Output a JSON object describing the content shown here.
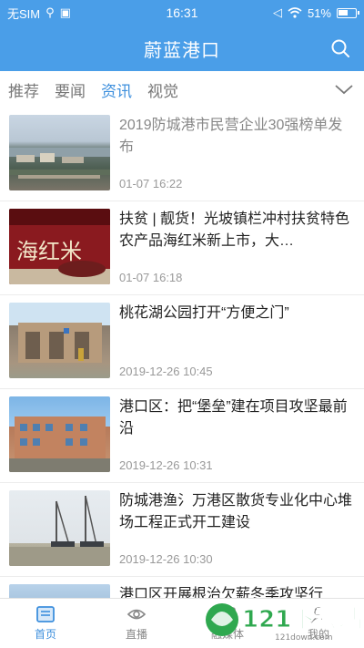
{
  "status_bar": {
    "carrier": "无SIM",
    "time": "16:31",
    "battery": "51%"
  },
  "header": {
    "title": "蔚蓝港口",
    "search_icon": "search-icon"
  },
  "tabs": {
    "items": [
      {
        "label": "推荐",
        "active": false
      },
      {
        "label": "要闻",
        "active": false
      },
      {
        "label": "资讯",
        "active": true
      },
      {
        "label": "视觉",
        "active": false
      }
    ],
    "expand_icon": "chevron-down-icon"
  },
  "news": [
    {
      "title": "2019防城港市民营企业30强榜单发布",
      "time": "01-07 16:22",
      "read": true
    },
    {
      "title": "扶贫 | 靓货！光坡镇栏冲村扶贫特色农产品海红米新上市，大…",
      "time": "01-07 16:18",
      "read": false,
      "thumb_text": "海红米"
    },
    {
      "title": "桃花湖公园打开“方便之门”",
      "time": "2019-12-26 10:45",
      "read": false
    },
    {
      "title": "港口区：把“堡垒”建在项目攻坚最前沿",
      "time": "2019-12-26 10:31",
      "read": false
    },
    {
      "title": "防城港渔氵万港区散货专业化中心堆场工程正式开工建设",
      "time": "2019-12-26 10:30",
      "read": false
    },
    {
      "title": "港口区开展根治欠薪冬季攻坚行",
      "time": "",
      "read": false
    }
  ],
  "bottom_nav": {
    "items": [
      {
        "label": "首页",
        "icon": "home-icon",
        "active": true
      },
      {
        "label": "直播",
        "icon": "eye-icon",
        "active": false
      },
      {
        "label": "融媒体",
        "icon": "media-icon",
        "active": false
      },
      {
        "label": "我的",
        "icon": "user-icon",
        "active": false
      }
    ]
  },
  "watermark": {
    "logo_text": "121下载站",
    "url": "121down.com"
  },
  "colors": {
    "brand": "#4a9ee8",
    "active_tab": "#3d8fdd",
    "watermark_green": "#2fa84f"
  }
}
